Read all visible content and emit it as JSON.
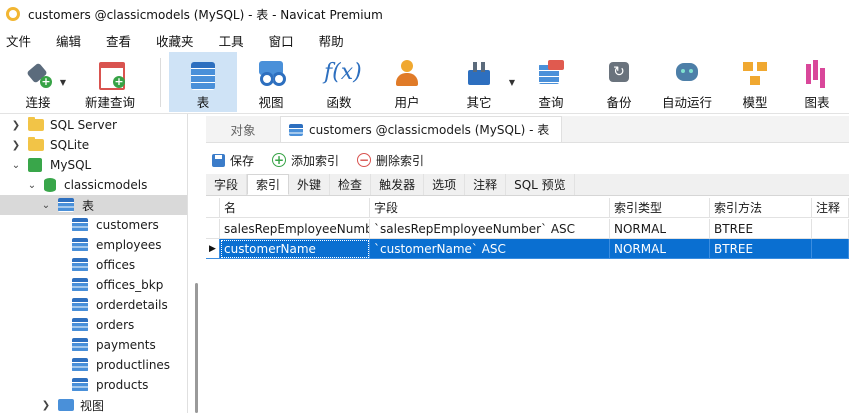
{
  "window": {
    "title": "customers @classicmodels (MySQL) - 表 - Navicat Premium"
  },
  "menu": [
    "文件",
    "编辑",
    "查看",
    "收藏夹",
    "工具",
    "窗口",
    "帮助"
  ],
  "toolbar": {
    "connect": "连接",
    "new_query": "新建查询",
    "table": "表",
    "view": "视图",
    "function": "函数",
    "user": "用户",
    "other": "其它",
    "query": "查询",
    "backup": "备份",
    "automation": "自动运行",
    "model": "模型",
    "chart": "图表",
    "function_glyph": "f(x)"
  },
  "sidebar": {
    "items": [
      {
        "label": "SQL Server"
      },
      {
        "label": "SQLite"
      },
      {
        "label": "MySQL"
      },
      {
        "label": "classicmodels"
      },
      {
        "label": "表"
      },
      {
        "label": "customers"
      },
      {
        "label": "employees"
      },
      {
        "label": "offices"
      },
      {
        "label": "offices_bkp"
      },
      {
        "label": "orderdetails"
      },
      {
        "label": "orders"
      },
      {
        "label": "payments"
      },
      {
        "label": "productlines"
      },
      {
        "label": "products"
      },
      {
        "label": "视图"
      }
    ]
  },
  "tabs": {
    "objects": "对象",
    "document": "customers @classicmodels (MySQL) - 表"
  },
  "actions": {
    "save": "保存",
    "add_index": "添加索引",
    "delete_index": "删除索引"
  },
  "subtabs": [
    "字段",
    "索引",
    "外键",
    "检查",
    "触发器",
    "选项",
    "注释",
    "SQL 预览"
  ],
  "grid": {
    "columns": [
      "名",
      "字段",
      "索引类型",
      "索引方法",
      "注释"
    ],
    "rows": [
      {
        "name": "salesRepEmployeeNumber",
        "field": "`salesRepEmployeeNumber` ASC",
        "type": "NORMAL",
        "method": "BTREE",
        "comment": ""
      },
      {
        "name": "customerName",
        "field": "`customerName` ASC",
        "type": "NORMAL",
        "method": "BTREE",
        "comment": ""
      }
    ]
  },
  "colors": {
    "accent": "#0a6fd1",
    "active_tool": "#cfe3f6",
    "folder": "#f2c447",
    "mysql": "#39a64a"
  }
}
